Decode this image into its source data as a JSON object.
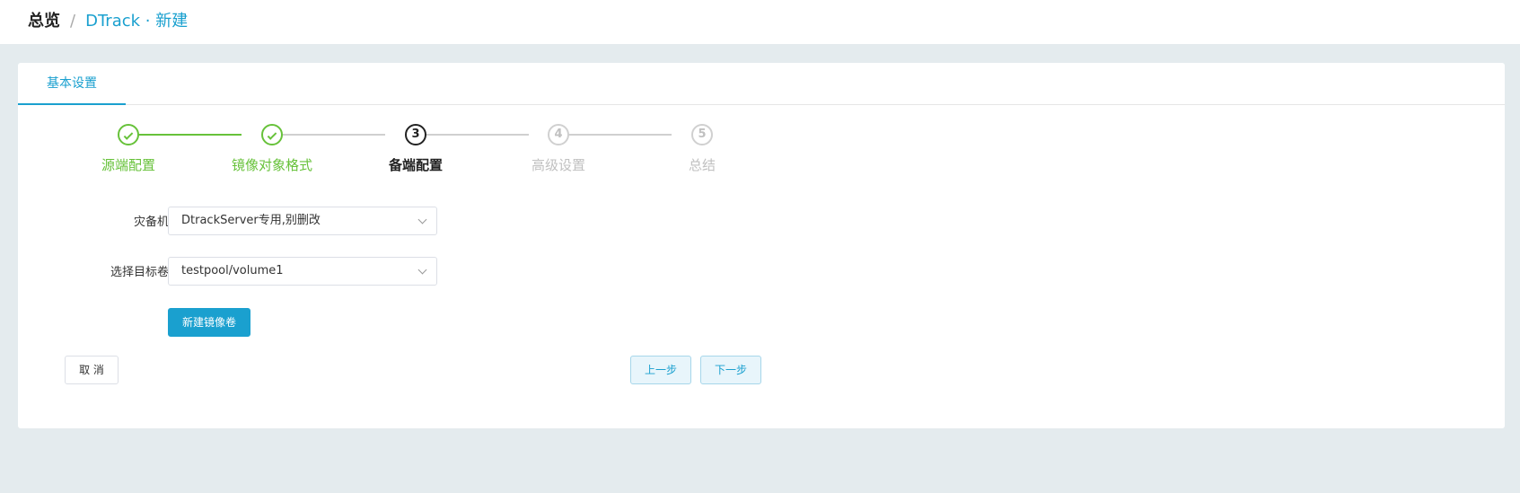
{
  "breadcrumb": {
    "root": "总览",
    "separator": "/",
    "current": "DTrack · 新建"
  },
  "tabs": [
    {
      "label": "基本设置"
    }
  ],
  "steps": [
    {
      "index": "1",
      "label": "源端配置",
      "status": "done"
    },
    {
      "index": "2",
      "label": "镜像对象格式",
      "status": "done"
    },
    {
      "index": "3",
      "label": "备端配置",
      "status": "active"
    },
    {
      "index": "4",
      "label": "高级设置",
      "status": "pending"
    },
    {
      "index": "5",
      "label": "总结",
      "status": "pending"
    }
  ],
  "form": {
    "dr_machine": {
      "label": "灾备机",
      "value": "DtrackServer专用,别删改"
    },
    "target_volume": {
      "label": "选择目标卷",
      "value": "testpool/volume1"
    },
    "new_volume_button": "新建镜像卷"
  },
  "footer": {
    "cancel": "取 消",
    "prev": "上一步",
    "next": "下一步"
  },
  "colors": {
    "accent": "#1aa0cf",
    "success": "#67c23a",
    "background": "#e4ebee"
  }
}
